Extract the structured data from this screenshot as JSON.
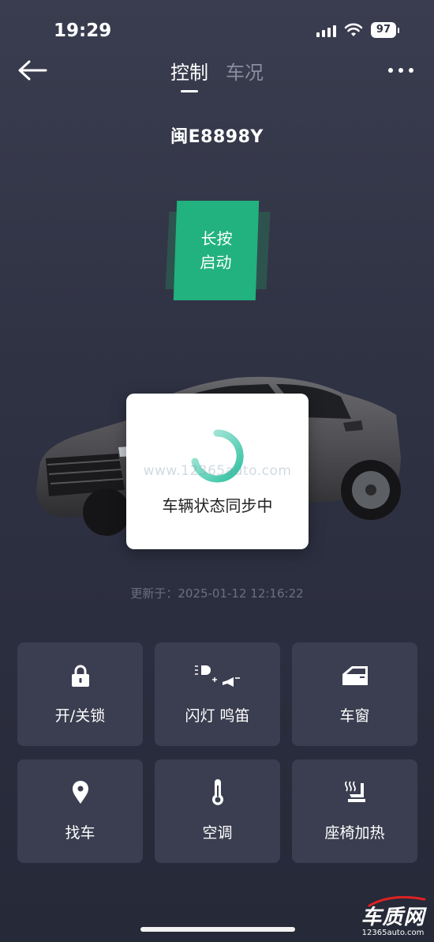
{
  "status_bar": {
    "time": "19:29",
    "battery": "97"
  },
  "nav": {
    "tabs": [
      {
        "label": "控制",
        "active": true
      },
      {
        "label": "车况",
        "active": false
      }
    ]
  },
  "vehicle": {
    "plate": "闽E8898Y"
  },
  "start_button": {
    "line1": "长按",
    "line2": "启动"
  },
  "sync_dialog": {
    "text": "车辆状态同步中",
    "watermark": "www.12365auto.com"
  },
  "updated": "更新于：2025-01-12 12:16:22",
  "controls": [
    {
      "label": "开/关锁",
      "icon": "lock-icon"
    },
    {
      "label": "闪灯 鸣笛",
      "icon": "light-horn-icon"
    },
    {
      "label": "车窗",
      "icon": "car-window-icon"
    },
    {
      "label": "找车",
      "icon": "location-pin-icon"
    },
    {
      "label": "空调",
      "icon": "thermometer-icon"
    },
    {
      "label": "座椅加热",
      "icon": "seat-heating-icon"
    }
  ],
  "brand": {
    "name": "车质网",
    "url": "12365auto.com"
  },
  "colors": {
    "accent_green": "#21b27f",
    "tile_bg": "#3b3e50",
    "background": "#2f3243"
  }
}
